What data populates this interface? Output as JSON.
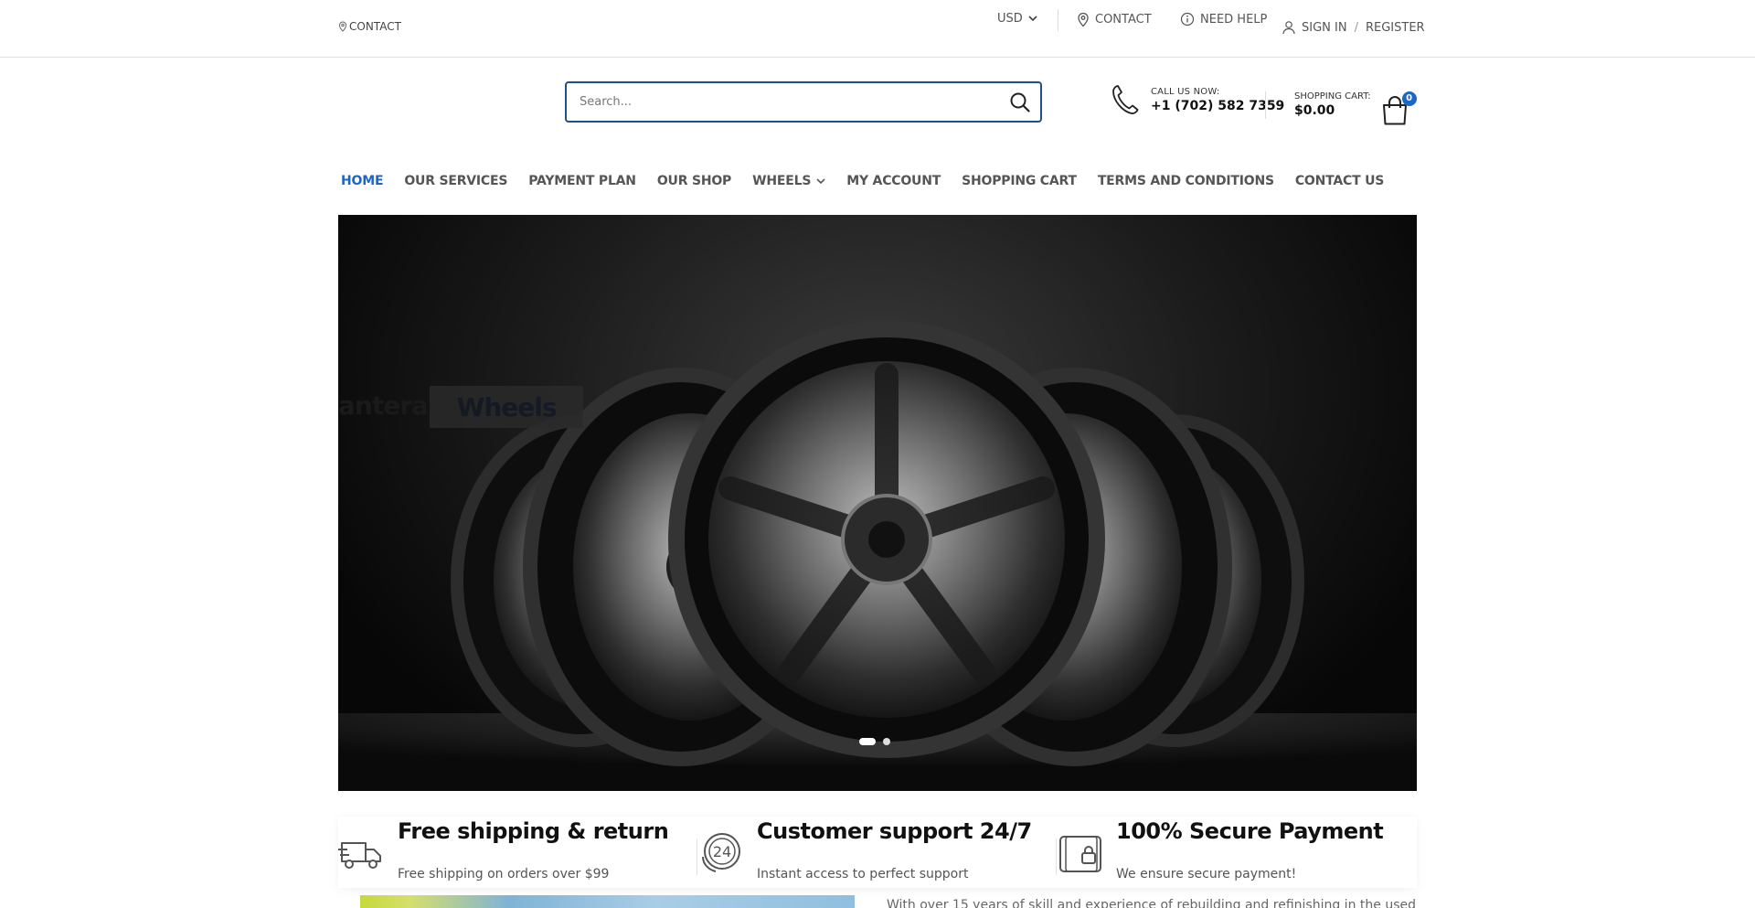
{
  "topbar": {
    "contact_left": "CONTACT",
    "currency": "USD",
    "contact": "CONTACT",
    "need_help": "NEED HELP",
    "sign_in": "SIGN IN",
    "separator": "/",
    "register": "REGISTER"
  },
  "header": {
    "search_placeholder": "Search...",
    "call_label": "CALL US NOW:",
    "phone": "+1 (702) 582 7359",
    "cart_label": "SHOPPING CART:",
    "cart_total": "$0.00",
    "cart_count": "0"
  },
  "nav": {
    "items": [
      {
        "label": "HOME",
        "active": true
      },
      {
        "label": "OUR SERVICES"
      },
      {
        "label": "PAYMENT PLAN"
      },
      {
        "label": "OUR SHOP"
      },
      {
        "label": "WHEELS",
        "has_dropdown": true
      },
      {
        "label": "MY ACCOUNT"
      },
      {
        "label": "SHOPPING CART"
      },
      {
        "label": "TERMS AND CONDITIONS"
      },
      {
        "label": "CONTACT US"
      }
    ]
  },
  "hero": {
    "brand_text": "antera",
    "button_text": "Wheels",
    "slides": 2,
    "active_slide": 1
  },
  "features": [
    {
      "icon": "truck-icon",
      "title": "Free shipping & return",
      "subtitle": "Free shipping on orders over $99"
    },
    {
      "icon": "support-24-icon",
      "title": "Customer support 24/7",
      "subtitle": "Instant access to perfect support"
    },
    {
      "icon": "wallet-lock-icon",
      "title": "100% Secure Payment",
      "subtitle": "We ensure secure payment!"
    }
  ],
  "below": {
    "text": "With over 15 years of skill and experience of rebuilding and refinishing in the used"
  },
  "colors": {
    "accent": "#1e66c5",
    "search_border": "#1f4e8c",
    "nav_text": "#555555"
  }
}
